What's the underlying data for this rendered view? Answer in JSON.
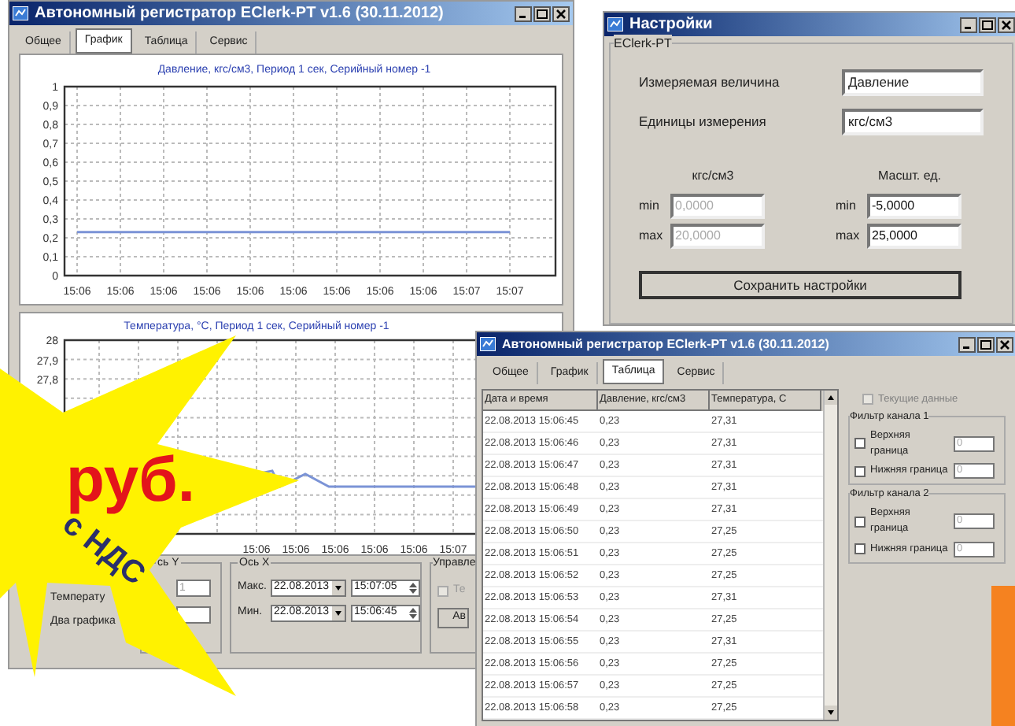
{
  "main_window": {
    "title": "Автономный регистратор EClerk-PT v1.6 (30.11.2012)",
    "tabs": [
      {
        "label": "Общее",
        "selected": false
      },
      {
        "label": "График",
        "selected": true
      },
      {
        "label": "Таблица",
        "selected": false
      },
      {
        "label": "Сервис",
        "selected": false
      }
    ],
    "chart_1": {
      "chart_data": {
        "type": "line",
        "title": "Давление, кгс/см3, Период 1 сек, Серийный номер -1",
        "categories": [
          "15:06",
          "15:06",
          "15:06",
          "15:06",
          "15:06",
          "15:06",
          "15:06",
          "15:06",
          "15:06",
          "15:07",
          "15:07"
        ],
        "grid": true,
        "series": [
          {
            "color": "#7b93d6",
            "values": [
              0.23,
              0.23,
              0.23,
              0.23,
              0.23,
              0.23,
              0.23,
              0.23,
              0.23,
              0.23,
              0.23
            ]
          }
        ],
        "ylim": [
          0,
          1
        ],
        "yticks": [
          {
            "value": 0,
            "label": "0"
          },
          {
            "value": 0.1,
            "label": "0,1"
          },
          {
            "value": 0.2,
            "label": "0,2"
          },
          {
            "value": 0.3,
            "label": "0,3"
          },
          {
            "value": 0.4,
            "label": "0,4"
          },
          {
            "value": 0.5,
            "label": "0,5"
          },
          {
            "value": 0.6,
            "label": "0,6"
          },
          {
            "value": 0.7,
            "label": "0,7"
          },
          {
            "value": 0.8,
            "label": "0,8"
          },
          {
            "value": 0.9,
            "label": "0,9"
          },
          {
            "value": 1,
            "label": "1"
          }
        ]
      }
    },
    "chart_2": {
      "title": "Температура, °C, Период 1 сек, Серийный номер -1",
      "y_labels": [
        "28",
        "27,9",
        "27,8"
      ],
      "x_labels": [
        "15:06",
        "15:06",
        "15:06",
        "15:06",
        "15:06",
        "15:07"
      ]
    },
    "display_options": [
      "Температу",
      "Два графика"
    ],
    "y_axis_group": {
      "label": "сь Y",
      "max": "1"
    },
    "x_axis_group": {
      "label": "Ось X",
      "max_label": "Макс.",
      "max_date": "22.08.2013",
      "max_time": "15:07:05",
      "min_label": "Мин.",
      "min_date": "22.08.2013",
      "min_time": "15:06:45"
    },
    "control_group": {
      "label": "Управле",
      "checkbox": {
        "label": "Те",
        "disabled": true
      },
      "button": "Ав"
    }
  },
  "settings_window": {
    "title": "Настройки",
    "group": "EClerk-PT",
    "fields": [
      {
        "label": "Измеряемая величина",
        "value": "Давление"
      },
      {
        "label": "Единицы измерения",
        "value": "кгс/см3"
      }
    ],
    "scales": [
      {
        "heading": "кгс/см3",
        "disabled": true,
        "rows": [
          {
            "label": "min",
            "value": "0,0000"
          },
          {
            "label": "max",
            "value": "20,0000"
          }
        ]
      },
      {
        "heading": "Масшт. ед.",
        "disabled": false,
        "rows": [
          {
            "label": "min",
            "value": "-5,0000"
          },
          {
            "label": "max",
            "value": "25,0000"
          }
        ]
      }
    ],
    "save_button": "Сохранить настройки"
  },
  "table_window": {
    "title": "Автономный регистратор EClerk-PT v1.6 (30.11.2012)",
    "tabs": [
      {
        "label": "Общее",
        "selected": false
      },
      {
        "label": "График",
        "selected": false
      },
      {
        "label": "Таблица",
        "selected": true
      },
      {
        "label": "Сервис",
        "selected": false
      }
    ],
    "table": {
      "columns": [
        "Дата и время",
        "Давление, кгс/см3",
        "Температура, С"
      ],
      "rows": [
        [
          "22.08.2013 15:06:45",
          "0,23",
          "27,31"
        ],
        [
          "22.08.2013 15:06:46",
          "0,23",
          "27,31"
        ],
        [
          "22.08.2013 15:06:47",
          "0,23",
          "27,31"
        ],
        [
          "22.08.2013 15:06:48",
          "0,23",
          "27,31"
        ],
        [
          "22.08.2013 15:06:49",
          "0,23",
          "27,31"
        ],
        [
          "22.08.2013 15:06:50",
          "0,23",
          "27,25"
        ],
        [
          "22.08.2013 15:06:51",
          "0,23",
          "27,25"
        ],
        [
          "22.08.2013 15:06:52",
          "0,23",
          "27,25"
        ],
        [
          "22.08.2013 15:06:53",
          "0,23",
          "27,31"
        ],
        [
          "22.08.2013 15:06:54",
          "0,23",
          "27,25"
        ],
        [
          "22.08.2013 15:06:55",
          "0,23",
          "27,31"
        ],
        [
          "22.08.2013 15:06:56",
          "0,23",
          "27,25"
        ],
        [
          "22.08.2013 15:06:57",
          "0,23",
          "27,25"
        ],
        [
          "22.08.2013 15:06:58",
          "0,23",
          "27,25"
        ]
      ]
    },
    "current_data": {
      "label": "Текущие данные",
      "checked": false,
      "disabled": true
    },
    "filters": [
      {
        "title": "Фильтр канала 1",
        "bounds": [
          {
            "label": "Верхняя граница",
            "checked": false,
            "value": "0"
          },
          {
            "label": "Нижняя граница",
            "checked": false,
            "value": "0"
          }
        ]
      },
      {
        "title": "Фильтр канала 2",
        "bounds": [
          {
            "label": "Верхняя граница",
            "checked": false,
            "value": "0"
          },
          {
            "label": "Нижняя граница",
            "checked": false,
            "value": "0"
          }
        ]
      }
    ]
  },
  "promo": {
    "price_unit": "руб.",
    "tax_note": "с НДС"
  }
}
